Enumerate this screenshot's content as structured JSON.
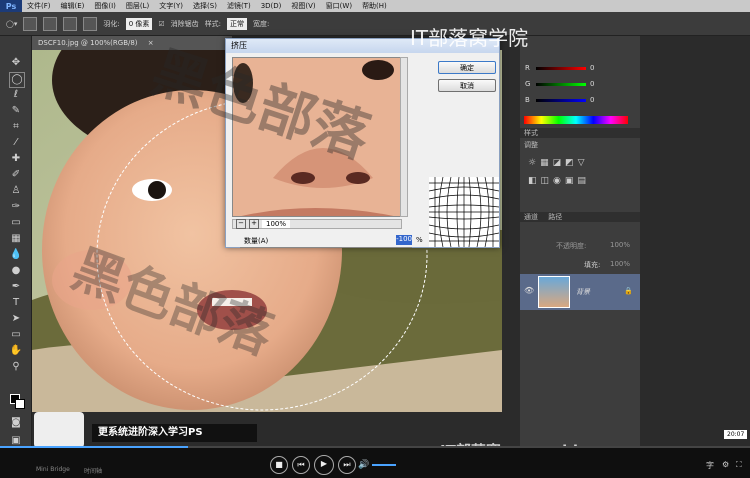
{
  "app": {
    "logo": "Ps"
  },
  "menu": [
    "文件(F)",
    "编辑(E)",
    "图像(I)",
    "图层(L)",
    "文字(Y)",
    "选择(S)",
    "滤镜(T)",
    "3D(D)",
    "视图(V)",
    "窗口(W)",
    "帮助(H)"
  ],
  "options": {
    "feather_label": "羽化:",
    "feather_value": "0 像素",
    "antialias_label": "消除锯齿",
    "style_label": "样式:",
    "style_value": "正常",
    "width_label": "宽度:"
  },
  "document": {
    "tab": "DSCF10.jpg @ 100%(RGB/8)"
  },
  "dialog": {
    "title": "挤压",
    "ok": "确定",
    "cancel": "取消",
    "zoom": "100%",
    "amount_label": "数量(A)",
    "amount_value": "-100",
    "percent": "%"
  },
  "color_panel": {
    "r": "R",
    "g": "G",
    "b": "B",
    "r_val": "0",
    "g_val": "0",
    "b_val": "0"
  },
  "panels": {
    "styles_tab": "样式",
    "adjust_tab": "调整",
    "channels_tab": "通道",
    "paths_tab": "路径",
    "opacity_label": "不透明度:",
    "opacity_value": "100%",
    "fill_label": "填充:",
    "fill_value": "100%",
    "layer_name": "背景"
  },
  "overlay": {
    "brand": "IT部落窝学院",
    "caption": "更系统进阶深入学习PS",
    "bottom_brand": "IT部落窝：www.blw",
    "wm1": "黑色部落",
    "wm2": "黑色部落",
    "time": "20:07"
  },
  "bottom_tabs": {
    "mini_bridge": "Mini Bridge",
    "timeline": "时间轴"
  },
  "player": {
    "progress": 0.25
  }
}
